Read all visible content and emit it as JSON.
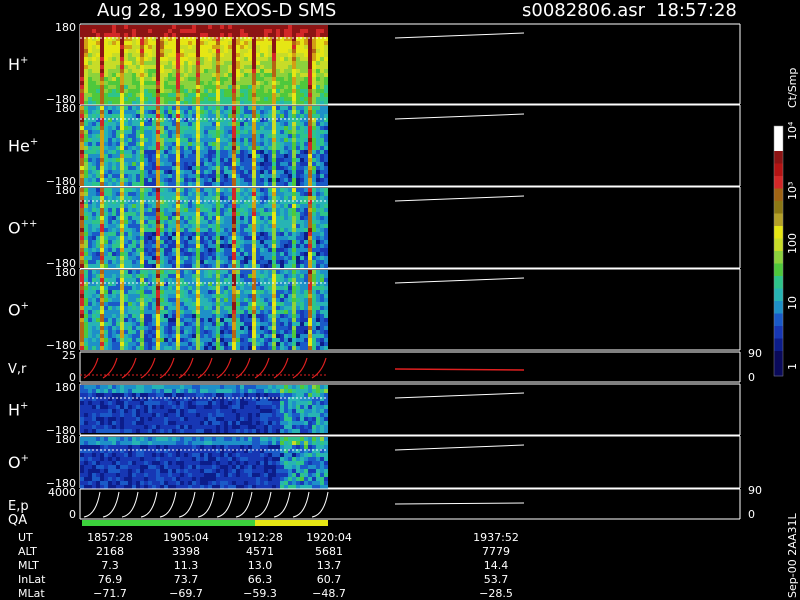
{
  "header": {
    "title": "Aug 28, 1990   EXOS-D SMS",
    "file": "s0082806.asr",
    "time": "18:57:28"
  },
  "side_label": "Sep-00 2AA31L",
  "colorbar": {
    "unit": "Ct/Smp",
    "labels": [
      "10⁴",
      "10³",
      "100",
      "10",
      "1"
    ]
  },
  "chart_data": {
    "type": "heatmap",
    "panels": [
      {
        "label": "H",
        "sup": "+",
        "yticks": [
          "180",
          "−180"
        ],
        "kind": "spec"
      },
      {
        "label": "He",
        "sup": "+",
        "yticks": [
          "180",
          "−180"
        ],
        "kind": "spec"
      },
      {
        "label": "O",
        "sup": "++",
        "yticks": [
          "180",
          "−180"
        ],
        "kind": "spec"
      },
      {
        "label": "O",
        "sup": "+",
        "yticks": [
          "180",
          "−180"
        ],
        "kind": "spec"
      },
      {
        "label": "V,r",
        "sup": "",
        "yticks": [
          "25",
          "0"
        ],
        "right_ticks": [
          "90",
          "0"
        ],
        "kind": "line"
      },
      {
        "label": "H",
        "sup": "+",
        "yticks": [
          "180",
          "−180"
        ],
        "kind": "spec2"
      },
      {
        "label": "O",
        "sup": "+",
        "yticks": [
          "180",
          "−180"
        ],
        "kind": "spec2"
      },
      {
        "label": "E,p",
        "sup": "",
        "yticks": [
          "4000",
          "0"
        ],
        "right_ticks": [
          "90",
          "0"
        ],
        "kind": "ep"
      }
    ],
    "qa_label": "QA",
    "columns": [
      "1857:28",
      "1905:04",
      "1912:28",
      "1920:04",
      "1937:52"
    ],
    "rows": [
      {
        "name": "UT",
        "values": [
          "1857:28",
          "1905:04",
          "1912:28",
          "1920:04",
          "1937:52"
        ]
      },
      {
        "name": "ALT",
        "values": [
          "2168",
          "3398",
          "4571",
          "5681",
          "7779"
        ]
      },
      {
        "name": "MLT",
        "values": [
          "7.3",
          "11.3",
          "13.0",
          "13.7",
          "14.4"
        ]
      },
      {
        "name": "InLat",
        "values": [
          "76.9",
          "73.7",
          "66.3",
          "60.7",
          "53.7"
        ]
      },
      {
        "name": "MLat",
        "values": [
          "−71.7",
          "−69.7",
          "−59.3",
          "−48.7",
          "−28.5"
        ]
      }
    ]
  }
}
